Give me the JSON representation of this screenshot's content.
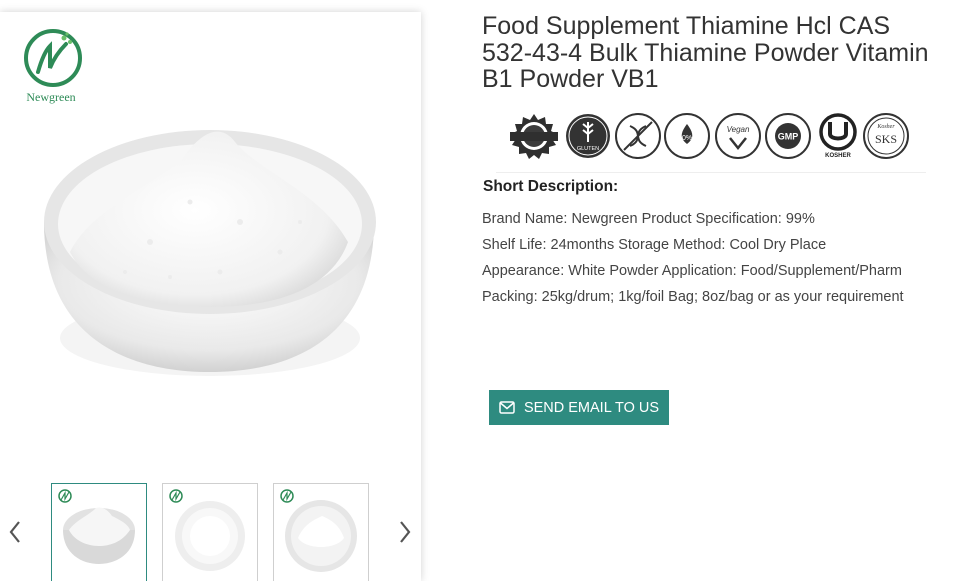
{
  "gallery": {
    "brand_name": "Newgreen",
    "thumbnails": [
      {
        "icon": "powder-bowl-thumbnail",
        "active": true
      },
      {
        "icon": "powder-plate-thumbnail",
        "active": false
      },
      {
        "icon": "powder-plate-thumbnail",
        "active": false
      }
    ],
    "prev_icon": "chevron-left-icon",
    "next_icon": "chevron-right-icon"
  },
  "product": {
    "title": "Food Supplement Thiamine Hcl CAS 532-43-4 Bulk Thiamine Powder Vitamin  B1 Powder VB1",
    "certifications": [
      {
        "icon": "natural-ingredients-badge"
      },
      {
        "icon": "gluten-free-badge",
        "text": "GLUTEN FREE"
      },
      {
        "icon": "gmo-free-badge",
        "text": "GMO FREE"
      },
      {
        "icon": "preservatives-free-badge",
        "text": "0%"
      },
      {
        "icon": "vegan-friendly-badge",
        "text": "Vegan FRIENDLY"
      },
      {
        "icon": "gmp-certified-badge",
        "text": "GMP"
      },
      {
        "icon": "kosher-badge",
        "text": "KOSHER"
      },
      {
        "icon": "sks-kosher-badge",
        "text": "SKS"
      }
    ],
    "short_description_heading": "Short Description:",
    "specs": [
      "Brand Name: Newgreen Product Specification: 99%",
      "Shelf Life: 24months Storage Method: Cool Dry Place",
      "Appearance: White Powder Application: Food/Supplement/Pharm",
      "Packing: 25kg/drum; 1kg/foil Bag; 8oz/bag or as your requirement"
    ],
    "email_button_label": "SEND EMAIL TO US",
    "email_icon": "envelope-icon"
  },
  "colors": {
    "accent": "#2e8b80",
    "brand_green": "#2e8b57"
  }
}
